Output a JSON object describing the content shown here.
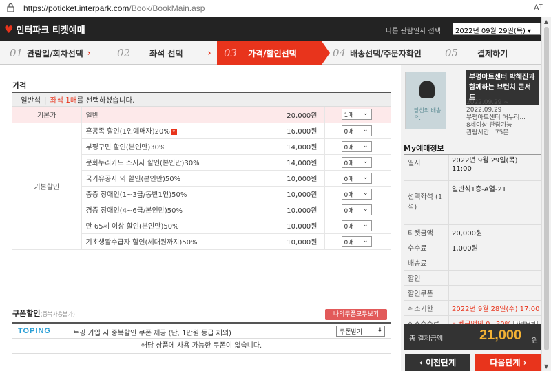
{
  "browser": {
    "url_host": "https://poticket.interpark.com",
    "url_path": "/Book/BookMain.asp",
    "reader_icon": "Aᵀ"
  },
  "header": {
    "logo": "인터파크 티켓예매",
    "date_label": "다른 관람일자 선택",
    "date_value": "2022년 09월 29일(목)"
  },
  "steps": [
    {
      "num": "01",
      "label": "관람일/회차선택"
    },
    {
      "num": "02",
      "label": "좌석 선택"
    },
    {
      "num": "03",
      "label": "가격/할인선택"
    },
    {
      "num": "04",
      "label": "배송선택/주문자확인"
    },
    {
      "num": "05",
      "label": "결제하기"
    }
  ],
  "price": {
    "title": "가격",
    "grade": "일반석",
    "grade_msg_red": "좌석 1매",
    "grade_msg": "를 선택하셨습니다.",
    "base": {
      "cat": "기본가",
      "name": "일반",
      "price": "20,000원",
      "qty": "1매"
    },
    "discount_cat": "기본할인",
    "discounts": [
      {
        "name": "혼공족 할인(1인예매자)20%",
        "price": "16,000원",
        "qty": "0매"
      },
      {
        "name": "부평구민 할인(본인만)30%",
        "price": "14,000원",
        "qty": "0매"
      },
      {
        "name": "문화누리카드 소지자 할인(본인만)30%",
        "price": "14,000원",
        "qty": "0매"
      },
      {
        "name": "국가유공자 외 할인(본인만)50%",
        "price": "10,000원",
        "qty": "0매"
      },
      {
        "name": "중증 장애인(1~3급/동반1인)50%",
        "price": "10,000원",
        "qty": "0매"
      },
      {
        "name": "경증 장애인(4~6급/본인만)50%",
        "price": "10,000원",
        "qty": "0매"
      },
      {
        "name": "만 65세 이상 할인(본인만)50%",
        "price": "10,000원",
        "qty": "0매"
      },
      {
        "name": "기초생활수급자 할인(세대원까지)50%",
        "price": "10,000원",
        "qty": "0매"
      }
    ]
  },
  "coupon": {
    "title": "쿠폰할인",
    "sub": "(중복사용불가)",
    "view_all": "나의쿠폰모두보기",
    "brand": "TOPING",
    "desc": "토핑 가입 시 중복할인 쿠폰 제공 (단, 1만원 등급 제외)",
    "get_btn": "쿠폰받기",
    "empty": "해당 상품에 사용 가능한 쿠폰이 없습니다."
  },
  "side": {
    "poster_text": "당신의 배송은.",
    "product_title": "부평아트센터 박혜진과 함께하는 브런치 콘서트",
    "period1": "2022.09.29 ~",
    "period2": "2022.09.29",
    "venue": "부평아트센터 해누리...",
    "age": "8세이상 관람가능",
    "runtime": "관람시간 : 75분",
    "my_title": "My예매정보",
    "rows": [
      {
        "k": "일시",
        "v": "2022년 9월 29일(목) 11:00"
      },
      {
        "k": "선택좌석 (1석)",
        "v": "일반석1층-A열-21"
      },
      {
        "k": "티켓금액",
        "v": "20,000원"
      },
      {
        "k": "수수료",
        "v": "1,000원"
      },
      {
        "k": "배송료",
        "v": ""
      },
      {
        "k": "할인",
        "v": ""
      },
      {
        "k": "할인쿠폰",
        "v": ""
      },
      {
        "k": "취소기한",
        "v": "2022년 9월 28일(수) 17:00"
      },
      {
        "k": "취소수수료",
        "v": "티켓금액의 0~30%",
        "btn": "상세보기"
      }
    ],
    "total_label": "총 결제금액",
    "total_value": "21,000",
    "total_unit": "원",
    "prev": "이전단계",
    "next": "다음단계"
  },
  "colors": {
    "accent": "#e8341c",
    "dark": "#232323"
  }
}
